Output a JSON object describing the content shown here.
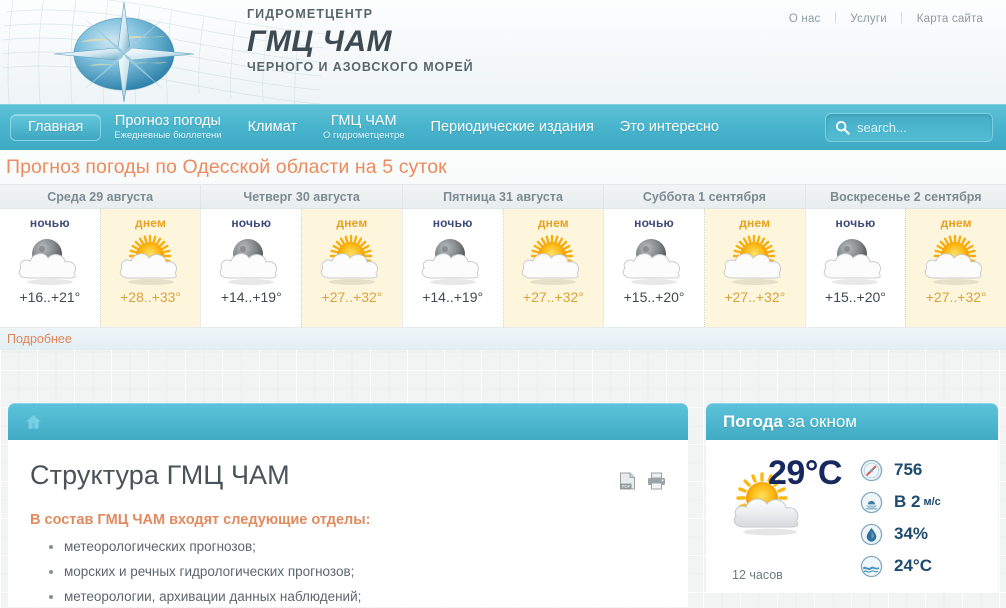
{
  "header": {
    "brand_top": "ГИДРОМЕТЦЕНТР",
    "brand_main": "ГМЦ ЧАМ",
    "brand_sub": "ЧЕРНОГО И АЗОВСКОГО МОРЕЙ",
    "top_links": [
      "О нас",
      "Услуги",
      "Карта сайта"
    ]
  },
  "nav": {
    "items": [
      {
        "title": "Главная",
        "subtitle": "",
        "active": true
      },
      {
        "title": "Прогноз погоды",
        "subtitle": "Ежедневные бюллетени",
        "active": false
      },
      {
        "title": "Климат",
        "subtitle": "",
        "active": false
      },
      {
        "title": "ГМЦ ЧАМ",
        "subtitle": "О гидрометцентре",
        "active": false
      },
      {
        "title": "Периодические издания",
        "subtitle": "",
        "active": false
      },
      {
        "title": "Это интересно",
        "subtitle": "",
        "active": false
      }
    ],
    "search_placeholder": "search...",
    "search_value": ""
  },
  "forecast": {
    "title": "Прогноз погоды по Одесской области на 5 суток",
    "more_label": "Подробнее",
    "night_label": "ночью",
    "day_label": "днем",
    "days": [
      {
        "name": "Среда 29 августа",
        "night_temp": "+16..+21°",
        "day_temp": "+28..+33°"
      },
      {
        "name": "Четверг 30 августа",
        "night_temp": "+14..+19°",
        "day_temp": "+27..+32°"
      },
      {
        "name": "Пятница 31 августа",
        "night_temp": "+14..+19°",
        "day_temp": "+27..+32°"
      },
      {
        "name": "Суббота 1 сентября",
        "night_temp": "+15..+20°",
        "day_temp": "+27..+32°"
      },
      {
        "name": "Воскресенье 2 сентября",
        "night_temp": "+15..+20°",
        "day_temp": "+27..+32°"
      }
    ]
  },
  "content": {
    "page_title": "Структура ГМЦ ЧАМ",
    "intro": "В состав ГМЦ ЧАМ входят следующие отделы:",
    "bullets": [
      "метеорологических прогнозов;",
      "морских и речных гидрологических прогнозов;",
      "метеорологии, архивации данных наблюдений;"
    ]
  },
  "widget": {
    "title_bold": "Погода",
    "title_rest": " за окном",
    "temperature": "29°C",
    "hours": "12 часов",
    "rows": [
      {
        "icon": "barometer-icon",
        "value": "756",
        "unit": ""
      },
      {
        "icon": "wind-icon",
        "value": "В 2",
        "unit": "м/с"
      },
      {
        "icon": "humidity-icon",
        "value": "34%",
        "unit": ""
      },
      {
        "icon": "water-temp-icon",
        "value": "24°C",
        "unit": ""
      }
    ]
  },
  "colors": {
    "accent_teal": "#49b5cd",
    "accent_orange": "#e08a5e",
    "night_text": "#3b4a7a",
    "day_text": "#e8a020",
    "widget_value": "#1e4a6d"
  }
}
